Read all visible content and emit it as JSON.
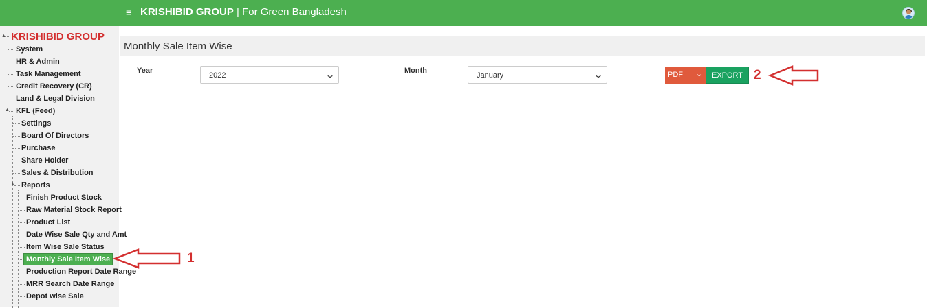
{
  "header": {
    "brand_name": "KRISHIBID GROUP",
    "brand_separator": " | ",
    "brand_tagline": "For Green Bangladesh",
    "menu_icon": "hamburger-icon",
    "avatar_icon": "user-avatar-icon",
    "accent_color": "#4caf50"
  },
  "sidebar": {
    "root": "KRISHIBID GROUP",
    "top_items": [
      {
        "label": "System"
      },
      {
        "label": "HR & Admin"
      },
      {
        "label": "Task Management"
      },
      {
        "label": "Credit Recovery (CR)"
      },
      {
        "label": "Land & Legal Division"
      },
      {
        "label": "KFL (Feed)"
      }
    ],
    "kfl_children": [
      {
        "label": "Settings"
      },
      {
        "label": "Board Of Directors"
      },
      {
        "label": "Purchase"
      },
      {
        "label": "Share Holder"
      },
      {
        "label": "Sales & Distribution"
      },
      {
        "label": "Reports"
      }
    ],
    "report_children": [
      {
        "label": "Finish Product Stock"
      },
      {
        "label": "Raw Material Stock Report"
      },
      {
        "label": "Product List"
      },
      {
        "label": "Date Wise Sale Qty and Amt"
      },
      {
        "label": "Item Wise Sale Status"
      },
      {
        "label": "Monthly Sale Item Wise",
        "active": true
      },
      {
        "label": "Production Report Date Range"
      },
      {
        "label": "MRR Search Date Range"
      },
      {
        "label": "Depot wise Sale"
      }
    ]
  },
  "main": {
    "page_title": "Monthly Sale Item Wise",
    "year_label": "Year",
    "year_value": "2022",
    "month_label": "Month",
    "month_value": "January",
    "format_value": "PDF",
    "export_label": "EXPORT"
  },
  "annotations": {
    "marker_1": "1",
    "marker_2": "2",
    "color": "#d32f2f"
  }
}
